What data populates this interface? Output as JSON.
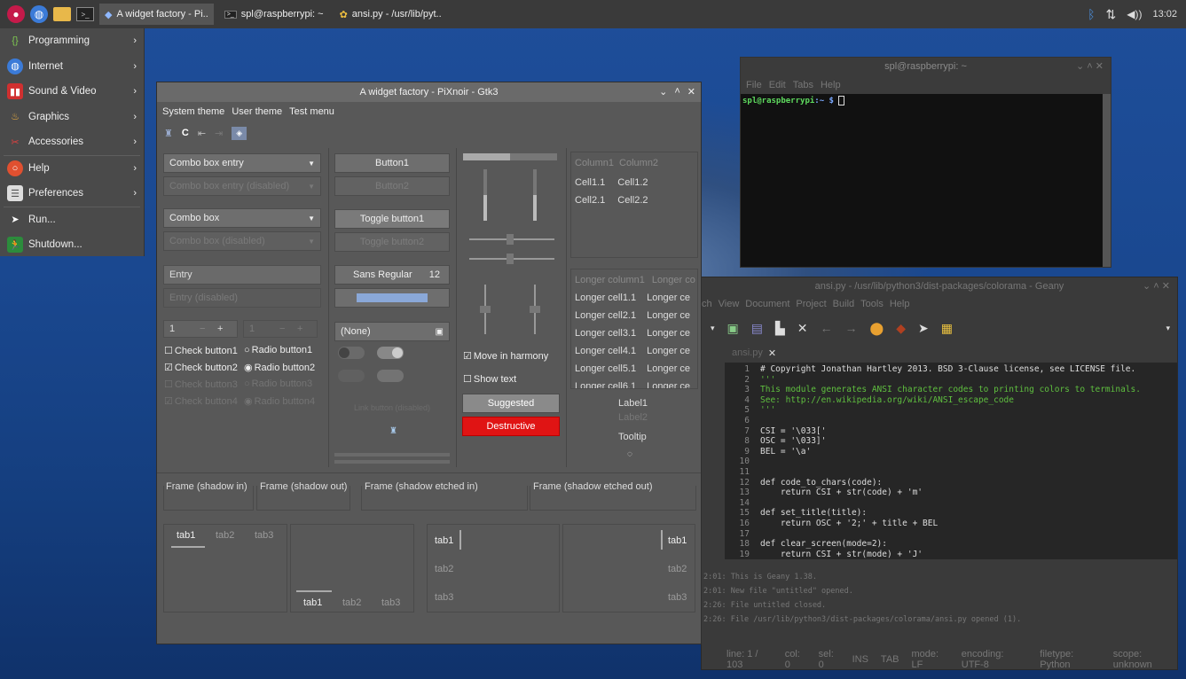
{
  "taskbar": {
    "tasks": [
      {
        "label": "A widget factory - Pi.."
      },
      {
        "label": "spl@raspberrypi: ~"
      },
      {
        "label": "ansi.py - /usr/lib/pyt.."
      }
    ],
    "clock": "13:02"
  },
  "menu": {
    "items": [
      {
        "label": "Programming",
        "has_submenu": true
      },
      {
        "label": "Internet",
        "has_submenu": true
      },
      {
        "label": "Sound & Video",
        "has_submenu": true
      },
      {
        "label": "Graphics",
        "has_submenu": true
      },
      {
        "label": "Accessories",
        "has_submenu": true
      },
      {
        "label": "Help",
        "has_submenu": true
      },
      {
        "label": "Preferences",
        "has_submenu": true
      },
      {
        "label": "Run...",
        "has_submenu": false
      },
      {
        "label": "Shutdown...",
        "has_submenu": false
      }
    ]
  },
  "widget_factory": {
    "title": "A widget factory - PiXnoir - Gtk3",
    "menus": [
      "System theme",
      "User theme",
      "Test menu"
    ],
    "combo_entry": "Combo box entry",
    "combo_entry_disabled": "Combo box entry (disabled)",
    "combo_box": "Combo box",
    "combo_box_disabled": "Combo box (disabled)",
    "entry": "Entry",
    "entry_disabled": "Entry (disabled)",
    "spin1": "1",
    "spin2": "1",
    "checks": [
      "Check button1",
      "Check button2",
      "Check button3",
      "Check button4"
    ],
    "radios": [
      "Radio button1",
      "Radio button2",
      "Radio button3",
      "Radio button4"
    ],
    "button1": "Button1",
    "button2": "Button2",
    "toggle1": "Toggle button1",
    "toggle2": "Toggle button2",
    "font_name": "Sans Regular",
    "font_size": "12",
    "file_chooser": "(None)",
    "link_disabled": "Link button (disabled)",
    "move_harmony": "Move in harmony",
    "show_text": "Show text",
    "suggested": "Suggested",
    "destructive": "Destructive",
    "tree1": {
      "headers": [
        "Column1",
        "Column2"
      ],
      "rows": [
        [
          "Cell1.1",
          "Cell1.2"
        ],
        [
          "Cell2.1",
          "Cell2.2"
        ]
      ]
    },
    "tree2": {
      "headers": [
        "Longer column1",
        "Longer co"
      ],
      "rows": [
        [
          "Longer cell1.1",
          "Longer ce"
        ],
        [
          "Longer cell2.1",
          "Longer ce"
        ],
        [
          "Longer cell3.1",
          "Longer ce"
        ],
        [
          "Longer cell4.1",
          "Longer ce"
        ],
        [
          "Longer cell5.1",
          "Longer ce"
        ],
        [
          "Longer cell6.1",
          "Longer ce"
        ]
      ]
    },
    "label1": "Label1",
    "label2": "Label2",
    "tooltip": "Tooltip",
    "frames": [
      "Frame (shadow in)",
      "Frame (shadow out)",
      "Frame (shadow etched in)",
      "Frame (shadow etched out)"
    ],
    "tabs": [
      "tab1",
      "tab2",
      "tab3"
    ],
    "accent": "#e01414",
    "suggested_color": "#8a8a8a"
  },
  "terminal": {
    "title": "spl@raspberrypi: ~",
    "menus": [
      "File",
      "Edit",
      "Tabs",
      "Help"
    ],
    "prompt_user": "spl@raspberrypi",
    "prompt_path": ":~ $ "
  },
  "geany": {
    "title": "ansi.py - /usr/lib/python3/dist-packages/colorama - Geany",
    "menus": [
      "ch",
      "View",
      "Document",
      "Project",
      "Build",
      "Tools",
      "Help"
    ],
    "tab": "ansi.py",
    "code": [
      {
        "n": "1",
        "t": "# Copyright Jonathan Hartley 2013. BSD 3-Clause license, see LICENSE file.",
        "c": "#dddddd"
      },
      {
        "n": "2",
        "t": "'''",
        "c": "#5fbf3f"
      },
      {
        "n": "3",
        "t": "This module generates ANSI character codes to printing colors to terminals.",
        "c": "#5fbf3f"
      },
      {
        "n": "4",
        "t": "See: http://en.wikipedia.org/wiki/ANSI_escape_code",
        "c": "#5fbf3f"
      },
      {
        "n": "5",
        "t": "'''",
        "c": "#5fbf3f"
      },
      {
        "n": "6",
        "t": "",
        "c": "#dddddd"
      },
      {
        "n": "7",
        "t": "CSI = '\\033['",
        "c": "#dddddd"
      },
      {
        "n": "8",
        "t": "OSC = '\\033]'",
        "c": "#dddddd"
      },
      {
        "n": "9",
        "t": "BEL = '\\a'",
        "c": "#dddddd"
      },
      {
        "n": "10",
        "t": "",
        "c": "#dddddd"
      },
      {
        "n": "11",
        "t": "",
        "c": "#dddddd"
      },
      {
        "n": "12",
        "t": "def code_to_chars(code):",
        "c": "#dddddd"
      },
      {
        "n": "13",
        "t": "    return CSI + str(code) + 'm'",
        "c": "#dddddd"
      },
      {
        "n": "14",
        "t": "",
        "c": "#dddddd"
      },
      {
        "n": "15",
        "t": "def set_title(title):",
        "c": "#dddddd"
      },
      {
        "n": "16",
        "t": "    return OSC + '2;' + title + BEL",
        "c": "#dddddd"
      },
      {
        "n": "17",
        "t": "",
        "c": "#dddddd"
      },
      {
        "n": "18",
        "t": "def clear_screen(mode=2):",
        "c": "#dddddd"
      },
      {
        "n": "19",
        "t": "    return CSI + str(mode) + 'J'",
        "c": "#dddddd"
      }
    ],
    "log": [
      "2:01: This is Geany 1.38.",
      "2:01: New file \"untitled\" opened.",
      "2:26: File untitled closed.",
      "2:26: File /usr/lib/python3/dist-packages/colorama/ansi.py opened (1)."
    ],
    "status": [
      "line: 1 / 103",
      "col: 0",
      "sel: 0",
      "INS",
      "TAB",
      "mode: LF",
      "encoding: UTF-8",
      "filetype: Python",
      "scope: unknown"
    ]
  }
}
